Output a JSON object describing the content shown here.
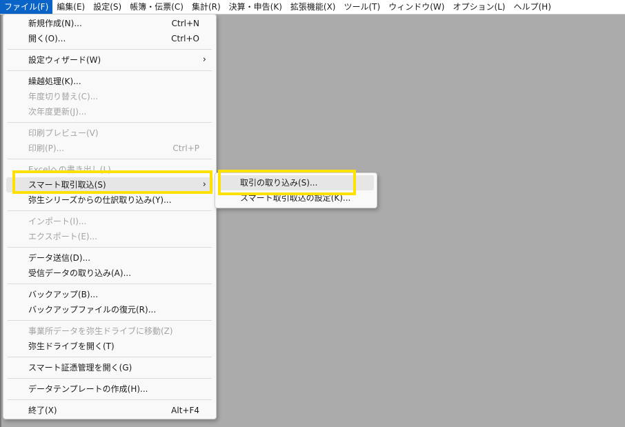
{
  "menubar": [
    {
      "label": "ファイル(F)",
      "active": true
    },
    {
      "label": "編集(E)"
    },
    {
      "label": "設定(S)"
    },
    {
      "label": "帳簿・伝票(C)"
    },
    {
      "label": "集計(R)"
    },
    {
      "label": "決算・申告(K)"
    },
    {
      "label": "拡張機能(X)"
    },
    {
      "label": "ツール(T)"
    },
    {
      "label": "ウィンドウ(W)"
    },
    {
      "label": "オプション(L)"
    },
    {
      "label": "ヘルプ(H)"
    }
  ],
  "file_menu": {
    "new": {
      "label": "新規作成(N)...",
      "shortcut": "Ctrl+N"
    },
    "open": {
      "label": "開く(O)...",
      "shortcut": "Ctrl+O"
    },
    "wizard": {
      "label": "設定ウィザード(W)",
      "arrow": "›"
    },
    "carry_forward": {
      "label": "繰越処理(K)..."
    },
    "year_switch": {
      "label": "年度切り替え(C)..."
    },
    "next_year_update": {
      "label": "次年度更新(J)..."
    },
    "print_preview": {
      "label": "印刷プレビュー(V)"
    },
    "print": {
      "label": "印刷(P)...",
      "shortcut": "Ctrl+P"
    },
    "excel_export": {
      "label": "Excelへの書き出し(L)..."
    },
    "smart_import": {
      "label": "スマート取引取込(S)",
      "arrow": "›"
    },
    "yayoi_import": {
      "label": "弥生シリーズからの仕訳取り込み(Y)..."
    },
    "import": {
      "label": "インポート(I)..."
    },
    "export": {
      "label": "エクスポート(E)..."
    },
    "data_send": {
      "label": "データ送信(D)..."
    },
    "received_import": {
      "label": "受信データの取り込み(A)..."
    },
    "backup": {
      "label": "バックアップ(B)..."
    },
    "restore": {
      "label": "バックアップファイルの復元(R)..."
    },
    "office_move": {
      "label": "事業所データを弥生ドライブに移動(Z)"
    },
    "open_drive": {
      "label": "弥生ドライブを開く(T)"
    },
    "evidence": {
      "label": "スマート証憑管理を開く(G)"
    },
    "template": {
      "label": "データテンプレートの作成(H)..."
    },
    "exit": {
      "label": "終了(X)",
      "shortcut": "Alt+F4"
    }
  },
  "sub_menu": {
    "import_transactions": {
      "label": "取引の取り込み(S)..."
    },
    "import_settings": {
      "label": "スマート取引取込の設定(K)..."
    }
  },
  "colors": {
    "highlight": "#ffe100",
    "menubar_active": "#0a64c8",
    "desktop": "#ababab"
  }
}
